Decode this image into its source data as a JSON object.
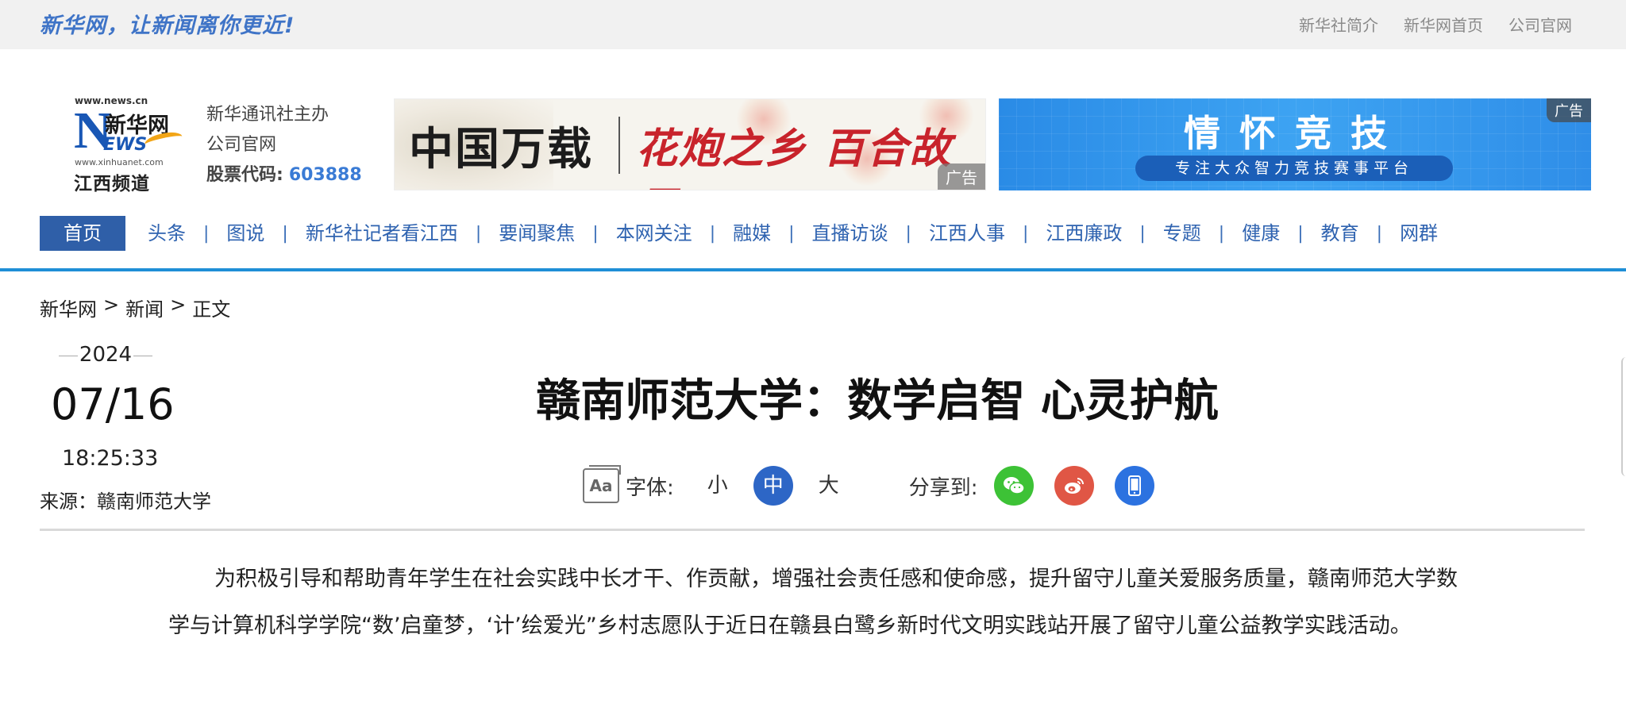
{
  "topbar": {
    "slogan": "新华网，让新闻离你更近!",
    "links": [
      "新华社简介",
      "新华网首页",
      "公司官网"
    ]
  },
  "logo": {
    "url_top": "www.news.cn",
    "brand": "新华网",
    "letter_n": "N",
    "letters_ews": "EWS",
    "url_bottom": "www.xinhuanet.com",
    "channel": "江西频道"
  },
  "hostinfo": {
    "line1": "新华通讯社主办",
    "line2": "公司官网",
    "stock_label": "股票代码:",
    "stock_code": "603888"
  },
  "ads": [
    {
      "text1": "中国万载",
      "text2": "花炮之乡 百合故里",
      "tag": "广告"
    },
    {
      "title": "情怀竞技",
      "subtitle": "专注大众智力竞技赛事平台",
      "tag": "广告"
    }
  ],
  "nav": {
    "items": [
      "首页",
      "头条",
      "图说",
      "新华社记者看江西",
      "要闻聚焦",
      "本网关注",
      "融媒",
      "直播访谈",
      "江西人事",
      "江西廉政",
      "专题",
      "健康",
      "教育",
      "网群"
    ],
    "active_index": 0,
    "divider": "|"
  },
  "breadcrumb": {
    "items": [
      "新华网",
      "新闻",
      "正文"
    ],
    "separator": ">"
  },
  "article_meta": {
    "year": "2024",
    "month_day": "07/16",
    "time": "18:25:33",
    "source": "来源：赣南师范大学"
  },
  "article": {
    "title": "赣南师范大学：数学启智 心灵护航",
    "font_label": "字体:",
    "font_sizes": [
      "小",
      "中",
      "大"
    ],
    "font_selected": "中",
    "share_label": "分享到:",
    "share_icons": [
      "wechat-icon",
      "weibo-icon",
      "mobile-icon"
    ],
    "body": "为积极引导和帮助青年学生在社会实践中长才干、作贡献，增强社会责任感和使命感，提升留守儿童关爱服务质量，赣南师范大学数学与计算机科学学院“数’启童梦，‘计’绘爱光”乡村志愿队于近日在赣县白鹭乡新时代文明实践站开展了留守儿童公益教学实践活动。"
  },
  "colors": {
    "brand_blue": "#2f5fa8",
    "nav_line": "#1f8fd6",
    "stock_code": "#3a7bd5",
    "wechat": "#3dc236",
    "weibo": "#e05645",
    "mobile": "#2c72e0"
  }
}
